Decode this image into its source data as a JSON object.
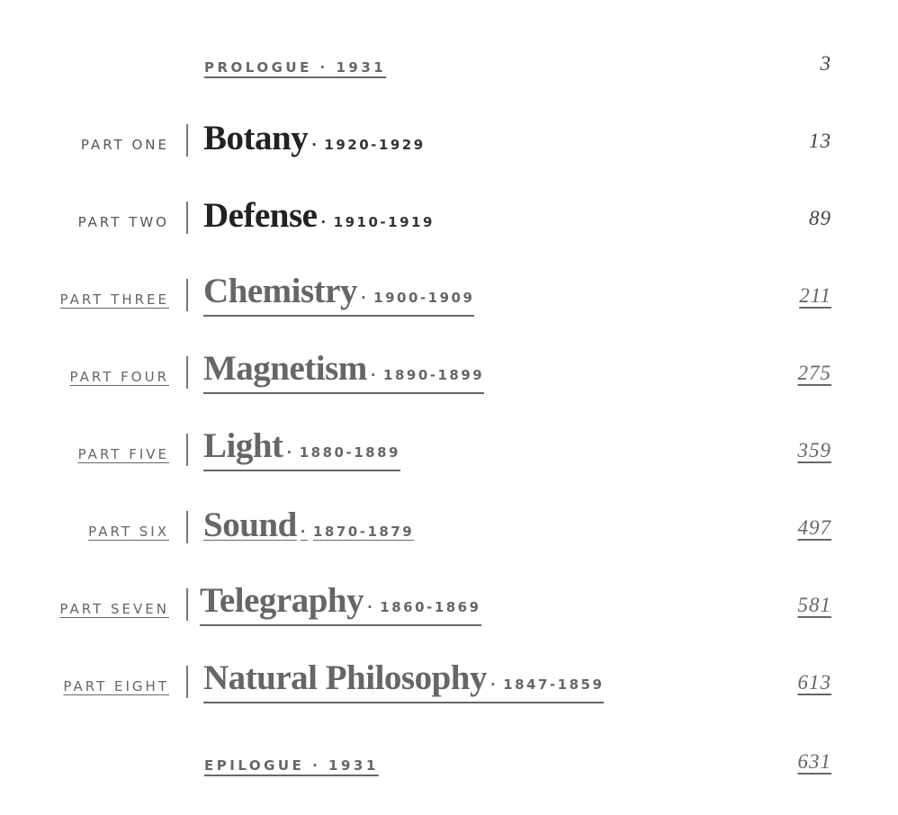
{
  "toc": {
    "prologue": {
      "label": "PROLOGUE",
      "year": "1931",
      "page": "3"
    },
    "parts": [
      {
        "part": "PART ONE",
        "title": "Botany",
        "years": "1920-1929",
        "page": "13",
        "linked": false
      },
      {
        "part": "PART TWO",
        "title": "Defense",
        "years": "1910-1919",
        "page": "89",
        "linked": false
      },
      {
        "part": "PART THREE",
        "title": "Chemistry",
        "years": "1900-1909",
        "page": "211",
        "linked": true
      },
      {
        "part": "PART FOUR",
        "title": "Magnetism",
        "years": "1890-1899",
        "page": "275",
        "linked": true
      },
      {
        "part": "PART FIVE",
        "title": "Light",
        "years": "1880-1889",
        "page": "359",
        "linked": true
      },
      {
        "part": "PART SIX",
        "title": "Sound",
        "years": "1870-1879",
        "page": "497",
        "linked": true
      },
      {
        "part": "PART SEVEN",
        "title": "Telegraphy",
        "years": "1860-1869",
        "page": "581",
        "linked": true
      },
      {
        "part": "PART EIGHT",
        "title": "Natural Philosophy",
        "years": "1847-1859",
        "page": "613",
        "linked": true
      }
    ],
    "epilogue": {
      "label": "EPILOGUE",
      "year": "1931",
      "page": "631"
    },
    "separator_dot": "·",
    "colors": {
      "text_dark": "#222222",
      "link_gray": "#666666",
      "background": "#ffffff"
    }
  }
}
